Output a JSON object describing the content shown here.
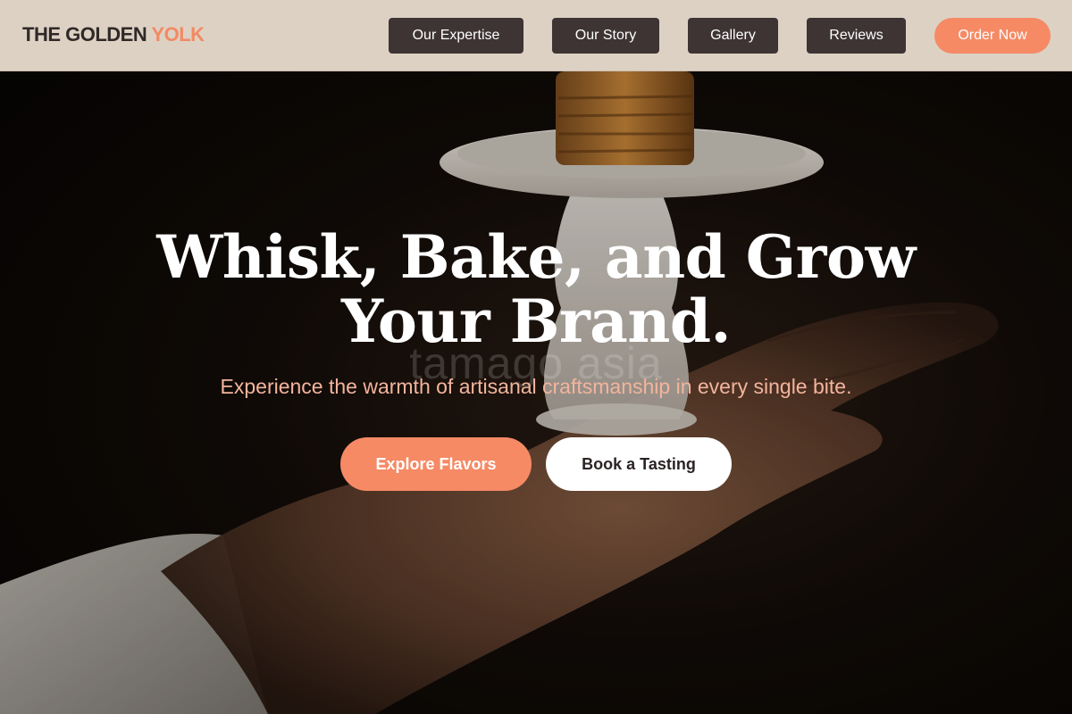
{
  "header": {
    "brand_main": "THE GOLDEN",
    "brand_accent": "YOLK",
    "nav": [
      {
        "label": "Our Expertise"
      },
      {
        "label": "Our Story"
      },
      {
        "label": "Gallery"
      },
      {
        "label": "Reviews"
      }
    ],
    "order_label": "Order Now"
  },
  "hero": {
    "headline_line1": "Whisk, Bake, and Grow",
    "headline_line2": "Your Brand.",
    "watermark": "tamago asia",
    "subheadline": "Experience the warmth of artisanal craftsmanship in every single bite.",
    "primary_cta": "Explore Flavors",
    "secondary_cta": "Book a Tasting"
  },
  "colors": {
    "accent": "#f58a65",
    "header_bg": "#ddd1c4",
    "nav_button_bg": "#3e3434",
    "subheadline": "#f3b49c"
  }
}
